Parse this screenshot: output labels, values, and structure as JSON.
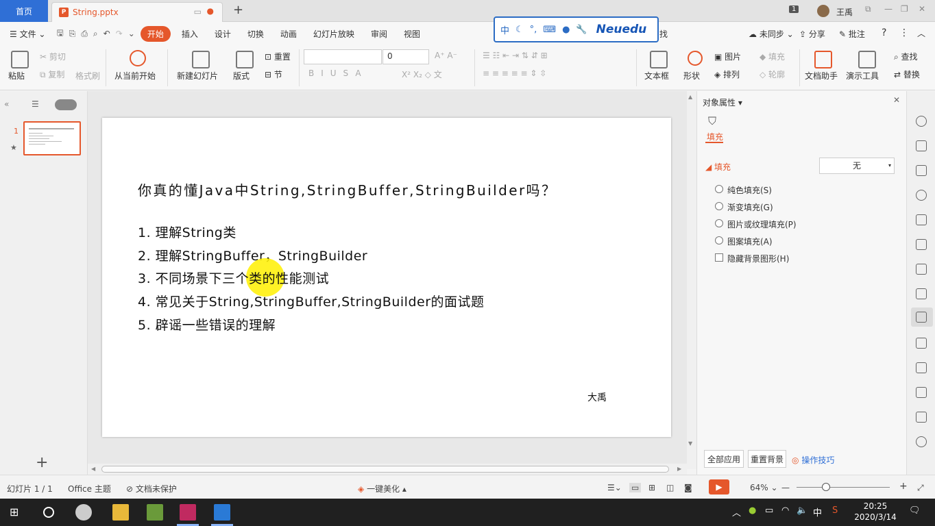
{
  "titlebar": {
    "home_tab": "首页",
    "file_tab": "String.pptx",
    "new_tab": "+",
    "badge": "1",
    "user": "王禹"
  },
  "menubar": {
    "file": "文件",
    "tabs": [
      "开始",
      "插入",
      "设计",
      "切换",
      "动画",
      "幻灯片放映",
      "审阅",
      "视图"
    ],
    "find_tail": "找",
    "sync": "未同步",
    "share": "分享",
    "comment": "批注"
  },
  "ime": {
    "mode": "中",
    "brand": "Neuedu"
  },
  "toolbar": {
    "paste": "粘贴",
    "cut": "剪切",
    "copy": "复制",
    "format_painter": "格式刷",
    "play_from_current": "从当前开始",
    "new_slide": "新建幻灯片",
    "layout": "版式",
    "reset": "重置",
    "section": "节",
    "font_size": "0",
    "textbox": "文本框",
    "shape": "形状",
    "picture": "图片",
    "arrange": "排列",
    "fill": "填充",
    "outline": "轮廓",
    "doc_assistant": "文档助手",
    "presentation_tools": "演示工具",
    "find": "查找",
    "replace": "替换"
  },
  "left_panel": {
    "slide_number": "1",
    "add": "+"
  },
  "slide": {
    "title": "你真的懂Java中String,StringBuffer,StringBuilder吗？",
    "items": [
      "1. 理解String类",
      "2. 理解StringBuffer，StringBuilder",
      "3. 不同场景下三个类的性能测试",
      "4. 常见关于String,StringBuffer,StringBuilder的面试题",
      "5. 辟谣一些错误的理解"
    ],
    "author": "大禹"
  },
  "right_panel": {
    "header": "对象属性",
    "tab_fill": "填充",
    "section": "填充",
    "fill_value": "无",
    "options": [
      "纯色填充(S)",
      "渐变填充(G)",
      "图片或纹理填充(P)",
      "图案填充(A)"
    ],
    "checkbox": "隐藏背景图形(H)",
    "apply_all": "全部应用",
    "reset_bg": "重置背景",
    "tips": "操作技巧"
  },
  "statusbar": {
    "slide_count": "幻灯片 1 / 1",
    "theme": "Office 主题",
    "protect": "文档未保护",
    "beautify": "一键美化",
    "zoom": "64%"
  },
  "taskbar": {
    "time": "20:25",
    "date": "2020/3/14",
    "ime": "中"
  },
  "colors": {
    "accent": "#e5572b",
    "home_tab": "#2f6fd6",
    "taskbar": "#202020"
  }
}
